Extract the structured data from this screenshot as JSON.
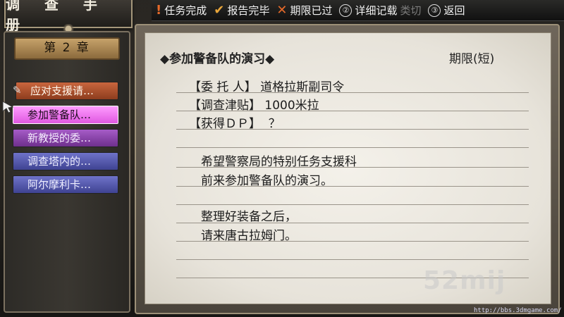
{
  "title": "调 查 手 册",
  "legend": {
    "complete": "任务完成",
    "reported": "报告完毕",
    "expired": "期限已过",
    "detail_key": "②",
    "detail": "详细记载",
    "faded": "类切",
    "back_key": "③",
    "back": "返回"
  },
  "chapter": "第 2 章",
  "missions": [
    "应对支援请…",
    "参加警备队…",
    "新教授的委…",
    "调查塔内的…",
    "阿尔摩利卡…"
  ],
  "document": {
    "title": "◆参加警备队的演习◆",
    "deadline": "期限(短)",
    "client": "【委 托 人】 道格拉斯副司令",
    "reward": "【调查津贴】 1000米拉",
    "dp": "【获得ＤＰ】  ？",
    "body1": "希望警察局的特别任务支援科",
    "body2": "前来参加警备队的演习。",
    "body3": "整理好装备之后，",
    "body4": "请来唐古拉姆门。"
  },
  "watermark": "52mij",
  "url": "http://bbs.3dmgame.com/"
}
